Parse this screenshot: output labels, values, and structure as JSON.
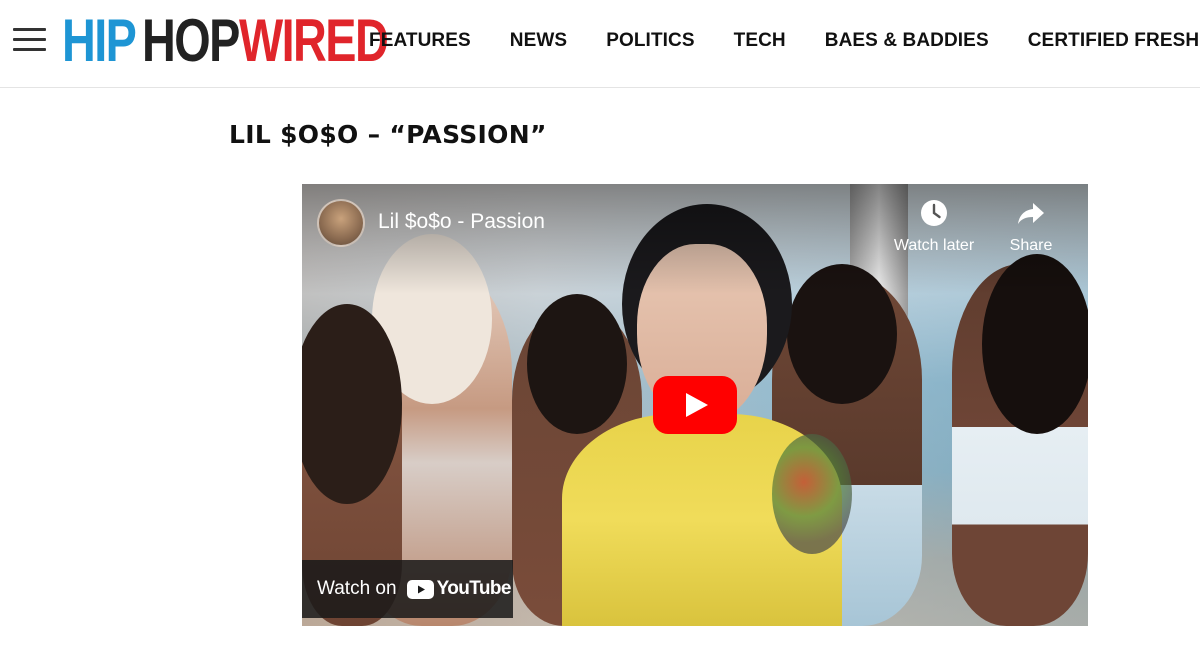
{
  "header": {
    "logo": {
      "part1": "HIP",
      "part2": "HOP",
      "part3": "WIRED"
    },
    "nav": [
      {
        "label": "FEATURES"
      },
      {
        "label": "NEWS"
      },
      {
        "label": "POLITICS"
      },
      {
        "label": "TECH"
      },
      {
        "label": "BAES & BADDIES"
      },
      {
        "label": "CERTIFIED FRESH"
      }
    ]
  },
  "article": {
    "title": "LIL $O$O – “PASSION”"
  },
  "video": {
    "title": "Lil $o$o - Passion",
    "watch_later_label": "Watch later",
    "share_label": "Share",
    "watch_on_label": "Watch on",
    "youtube_label": "YouTube"
  },
  "colors": {
    "logo_blue": "#1e95d4",
    "logo_black": "#222222",
    "logo_red": "#e0252b",
    "youtube_red": "#ff0000"
  },
  "icons": [
    "menu-icon",
    "clock-icon",
    "share-arrow-icon",
    "play-icon",
    "youtube-logo-icon"
  ]
}
